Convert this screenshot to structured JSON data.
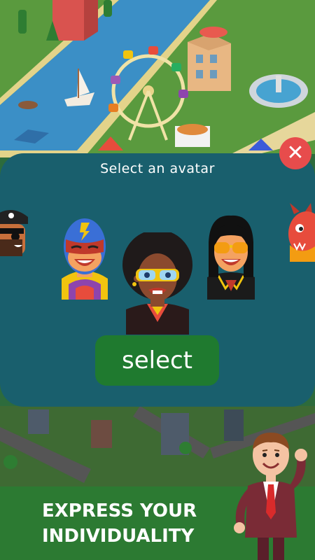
{
  "dialog": {
    "title": "Select an avatar",
    "select_label": "select"
  },
  "avatars": [
    {
      "name": "pirate"
    },
    {
      "name": "superhero"
    },
    {
      "name": "afro-disco",
      "selected": true
    },
    {
      "name": "rock-star"
    },
    {
      "name": "dragon"
    }
  ],
  "banner": {
    "line1": "EXPRESS YOUR",
    "line2": "INDIVIDUALITY"
  },
  "colors": {
    "dialog_bg": "#195f6d",
    "close_button": "#e74c4c",
    "select_button": "#1f7a2f",
    "banner_bg": "#2c7a32"
  }
}
